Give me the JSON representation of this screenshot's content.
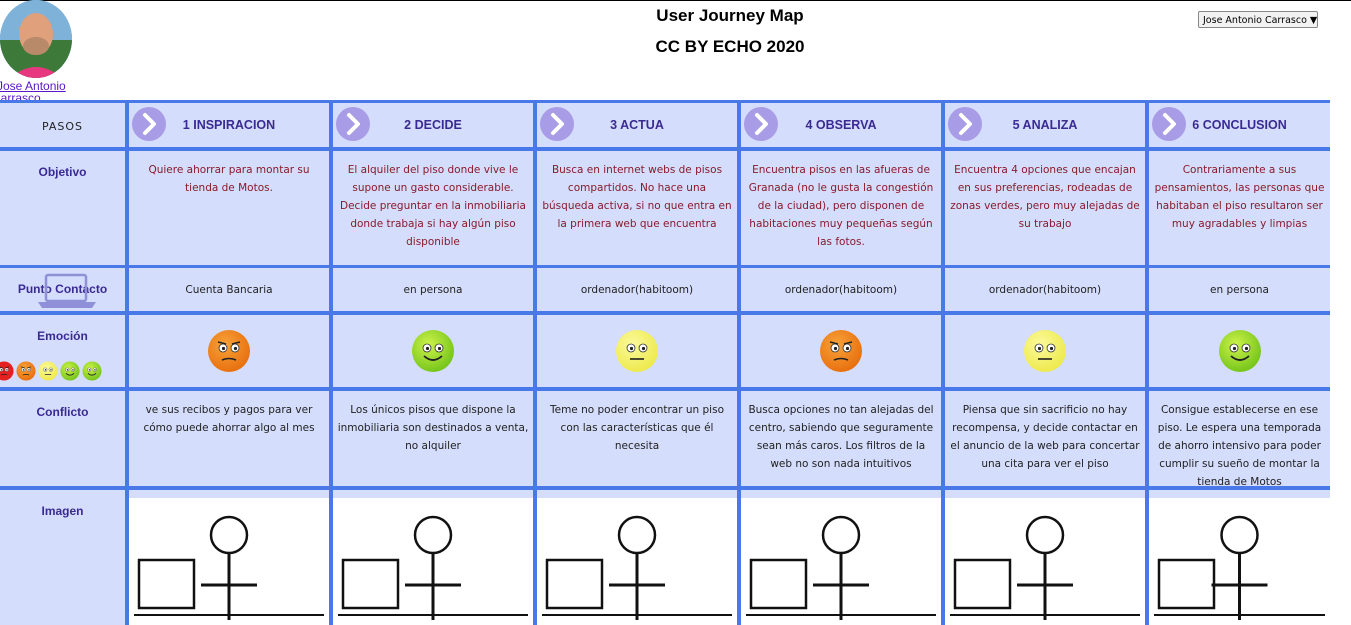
{
  "header": {
    "title": "User Journey Map",
    "subtitle": "CC BY ECHO 2020",
    "user_select": "Jose Antonio Carrasco ▼"
  },
  "profile": {
    "name_line1": "Jose Antonio",
    "name_line2": "Carrasco"
  },
  "rows": {
    "pasos": "PASOS",
    "objetivo": "Objetivo",
    "punto_contacto": "Punto Contacto",
    "emocion": "Emoción",
    "conflicto": "Conflicto",
    "imagen": "Imagen"
  },
  "steps": [
    {
      "label": "1 INSPIRACION",
      "objetivo": "Quiere ahorrar para montar su tienda de Motos.",
      "contacto": "Cuenta Bancaria",
      "emotion": "annoyed",
      "conflicto": "ve sus recibos y pagos para ver cómo puede ahorrar algo al mes"
    },
    {
      "label": "2 DECIDE",
      "objetivo": "El alquiler del piso donde vive le supone un gasto considerable. Decide preguntar en la inmobiliaria donde trabaja si hay algún piso disponible",
      "contacto": "en persona",
      "emotion": "happy",
      "conflicto": "Los únicos pisos que dispone la inmobiliaria son destinados a venta, no alquiler"
    },
    {
      "label": "3 ACTUA",
      "objetivo": "Busca en internet webs de pisos compartidos. No hace una búsqueda activa, si no que entra en la primera web que encuentra",
      "contacto": "ordenador(habitoom)",
      "emotion": "neutral",
      "conflicto": "Teme no poder encontrar un piso con las características que él necesita"
    },
    {
      "label": "4 OBSERVA",
      "objetivo": "Encuentra pisos en las afueras de Granada (no le gusta la congestión de la ciudad), pero disponen de habitaciones muy pequeñas según las fotos.",
      "contacto": "ordenador(habitoom)",
      "emotion": "annoyed",
      "conflicto": "Busca opciones no tan alejadas del centro, sabiendo que seguramente sean más caros. Los filtros de la web no son nada intuitivos"
    },
    {
      "label": "5 ANALIZA",
      "objetivo": "Encuentra 4 opciones que encajan en sus preferencias, rodeadas de zonas verdes, pero muy alejadas de su trabajo",
      "contacto": "ordenador(habitoom)",
      "emotion": "neutral",
      "conflicto": "Piensa que sin sacrificio no hay recompensa, y decide contactar en el anuncio de la web para concertar una cita para ver el piso"
    },
    {
      "label": "6 CONCLUSION",
      "objetivo": "Contrariamente a sus pensamientos, las personas que habitaban el piso resultaron ser muy agradables y limpias",
      "contacto": "en persona",
      "emotion": "happy",
      "conflicto": "Consigue establecerse en ese piso. Le espera una temporada de ahorro intensivo para poder cumplir su sueño de montar la tienda de Motos"
    }
  ],
  "colors": {
    "grid": "#4978e8",
    "cell": "#d4ddfb",
    "label": "#3a2a94",
    "objective_text": "#8a1a2c",
    "chevron": "#a99ce6"
  }
}
